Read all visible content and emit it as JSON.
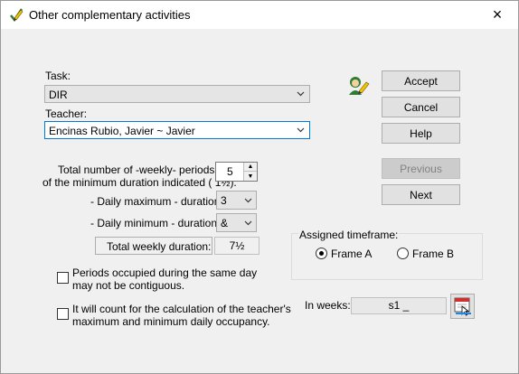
{
  "window": {
    "title": "Other complementary activities",
    "close_icon": "×"
  },
  "task": {
    "label": "Task:",
    "value": "DIR"
  },
  "teacher": {
    "label": "Teacher:",
    "value": "Encinas Rubio, Javier ~ Javier"
  },
  "periods": {
    "label_line1": "Total number of -weekly- periods",
    "label_line2": "of the minimum duration indicated ( 1½):",
    "value": "5"
  },
  "daily_max": {
    "label": "- Daily maximum -  duration:",
    "value": "3"
  },
  "daily_min": {
    "label": "- Daily minimum -   duration:",
    "value": "&"
  },
  "weekly_duration": {
    "label": "Total weekly duration:",
    "value": "7½"
  },
  "options": {
    "non_contiguous": "Periods occupied during the same day may not be contiguous.",
    "count_occupancy": "It will count for the calculation of the teacher's maximum and minimum daily occupancy."
  },
  "timeframe": {
    "label": "Assigned timeframe:",
    "frame_a": "Frame A",
    "frame_b": "Frame B",
    "selected": "Frame A"
  },
  "weeks": {
    "label": "In weeks:",
    "value": "s1 _"
  },
  "buttons": {
    "accept": "Accept",
    "cancel": "Cancel",
    "help": "Help",
    "previous": "Previous",
    "next": "Next"
  },
  "icons": {
    "title": "pencil-check-icon",
    "teacher": "teacher-pencil-icon",
    "calendar": "calendar-pointer-icon"
  }
}
